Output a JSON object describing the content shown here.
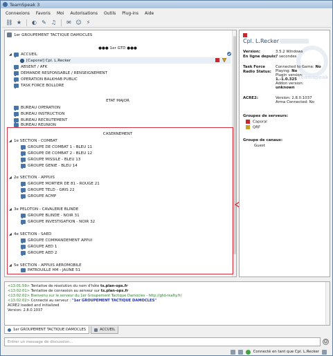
{
  "window": {
    "title": "TeamSpeak 3"
  },
  "menu": [
    "Connexions",
    "Favoris",
    "Moi",
    "Autorisations",
    "Outils",
    "Plug-ins",
    "Aide"
  ],
  "toolbar": {
    "icons": [
      "connect-icon",
      "bookmark-icon",
      "away-icon",
      "mic-mute-icon",
      "speaker-mute-icon",
      "chat-icon",
      "user-icon",
      "plugin-icon"
    ]
  },
  "tree": {
    "server": "1er GROUPEMENT TACTIQUE DAMOCLES",
    "spacer_gtd": "●●● 1er GTD ●●●",
    "accueil": "ACCUEIL",
    "user": "[Caporal] Cpl. L.Recker",
    "absent": "ABSENT / AFK",
    "demande": "DEMANDE RESPONSABLE / RENSEIGNEMENT",
    "balkhab": "OPERATION BALKHAB PUBLIC",
    "tf_bollore": "TASK FORCE BOLLORE",
    "spacer_etat": "ETAT MAJOR",
    "bureau_op": "BUREAU OPERATION",
    "bureau_instr": "BUREAU INSTRUCTION",
    "bureau_recr": "BUREAU RECRUTEMENT",
    "bureau_reunion": "BUREAU REUNION",
    "spacer_cas": "CASERNEMENT",
    "section1": "1e SECTION - COMBAT",
    "s1g1": "GROUPE DE COMBAT 1 - BLEU 11",
    "s1g2": "GROUPE DE COMBAT 2 - BLEU 12",
    "s1g3": "GROUPE MISSILE - BLEU 13",
    "s1g4": "GROUPE GENIE - BLEU 14",
    "section2": "2e SECTION - APPUIS",
    "s2g1": "GROUPE MORTIER DE 81 - ROUGE 21",
    "s2g2": "GROUPE TELD - GRIS 22",
    "s2g3": "GROUPE ACMP",
    "section3": "3e PELOTON - CAVALERIE BLINDE",
    "s3g1": "GROUPE BLINDE - NOIR 31",
    "s3g2": "GROUPE INVESTIGATION - NOIR 32",
    "section4": "4e SECTION - SAED",
    "s4g1": "GROUPE COMMANDEMENT APPUI",
    "s4g2": "GROUPE AED 1",
    "s4g3": "GROUPE AED 2",
    "section5": "5e SECTION - APPUIS AEROMOBILE",
    "s5g1": "PATROUILLE HM - JAUNE 51"
  },
  "info": {
    "name": "Cpl. L.Recker",
    "watermark": "teamspeak",
    "version_label": "Version:",
    "version_value": "3.5.2 Windows",
    "online_label": "En ligne depuis:",
    "online_value": "7 secondes",
    "tfr_label": "Task Force Radio Status:",
    "tfr_connected_label": "Connected to Game:",
    "tfr_connected_value": "No",
    "tfr_playing_label": "Playing:",
    "tfr_playing_value": "No",
    "tfr_plugin_label": "Plugin version:",
    "tfr_plugin_value": "1.-1.0.325",
    "tfr_addon_label": "Addon version:",
    "tfr_addon_value": "unknown",
    "acre_label": "ACRE2:",
    "acre_version": "Version: 2.8.0.1037",
    "acre_arma": "Arma Connected: No",
    "groups_label": "Groupes de serveurs:",
    "group1": "Caporal",
    "group2": "QRF",
    "channel_group_label": "Groupe de canaux:",
    "channel_group": "Guest"
  },
  "log": {
    "l1_ts": "<13:01:59>",
    "l1_text": "Tentative de résolution du nom d'hôte",
    "l1_host": "ts.plan-ops.fr",
    "l2_ts": "<13:02:01>",
    "l2_text": "Tentative de connexion au serveur sur",
    "l2_host": "ts.plan-ops.fr",
    "l3_ts": "<13:02:02>",
    "l3_text": "Bienvenu sur le serveur du 1er Groupement Tactique Damocles - http://gtd-realty.fr/",
    "l4_ts": "<13:02:02>",
    "l4_text": "Connecté au serveur :",
    "l4_server": "\"1er GROUPEMENT TACTIQUE DAMOCLES\"",
    "l5": "ACRE2 loaded and initialized",
    "l6": "Version: 2.8.0.1037"
  },
  "tabs": [
    "1er GROUPEMENT TACTIQUE DAMOCLES",
    "ACCUEIL"
  ],
  "chat": {
    "placeholder": "Entrer un message de discussion..."
  },
  "status": {
    "text": "Connecté en tant que Cpl. L.Recker"
  },
  "colors": {
    "highlight": "#d9333f",
    "accent": "#2b4e7a"
  }
}
